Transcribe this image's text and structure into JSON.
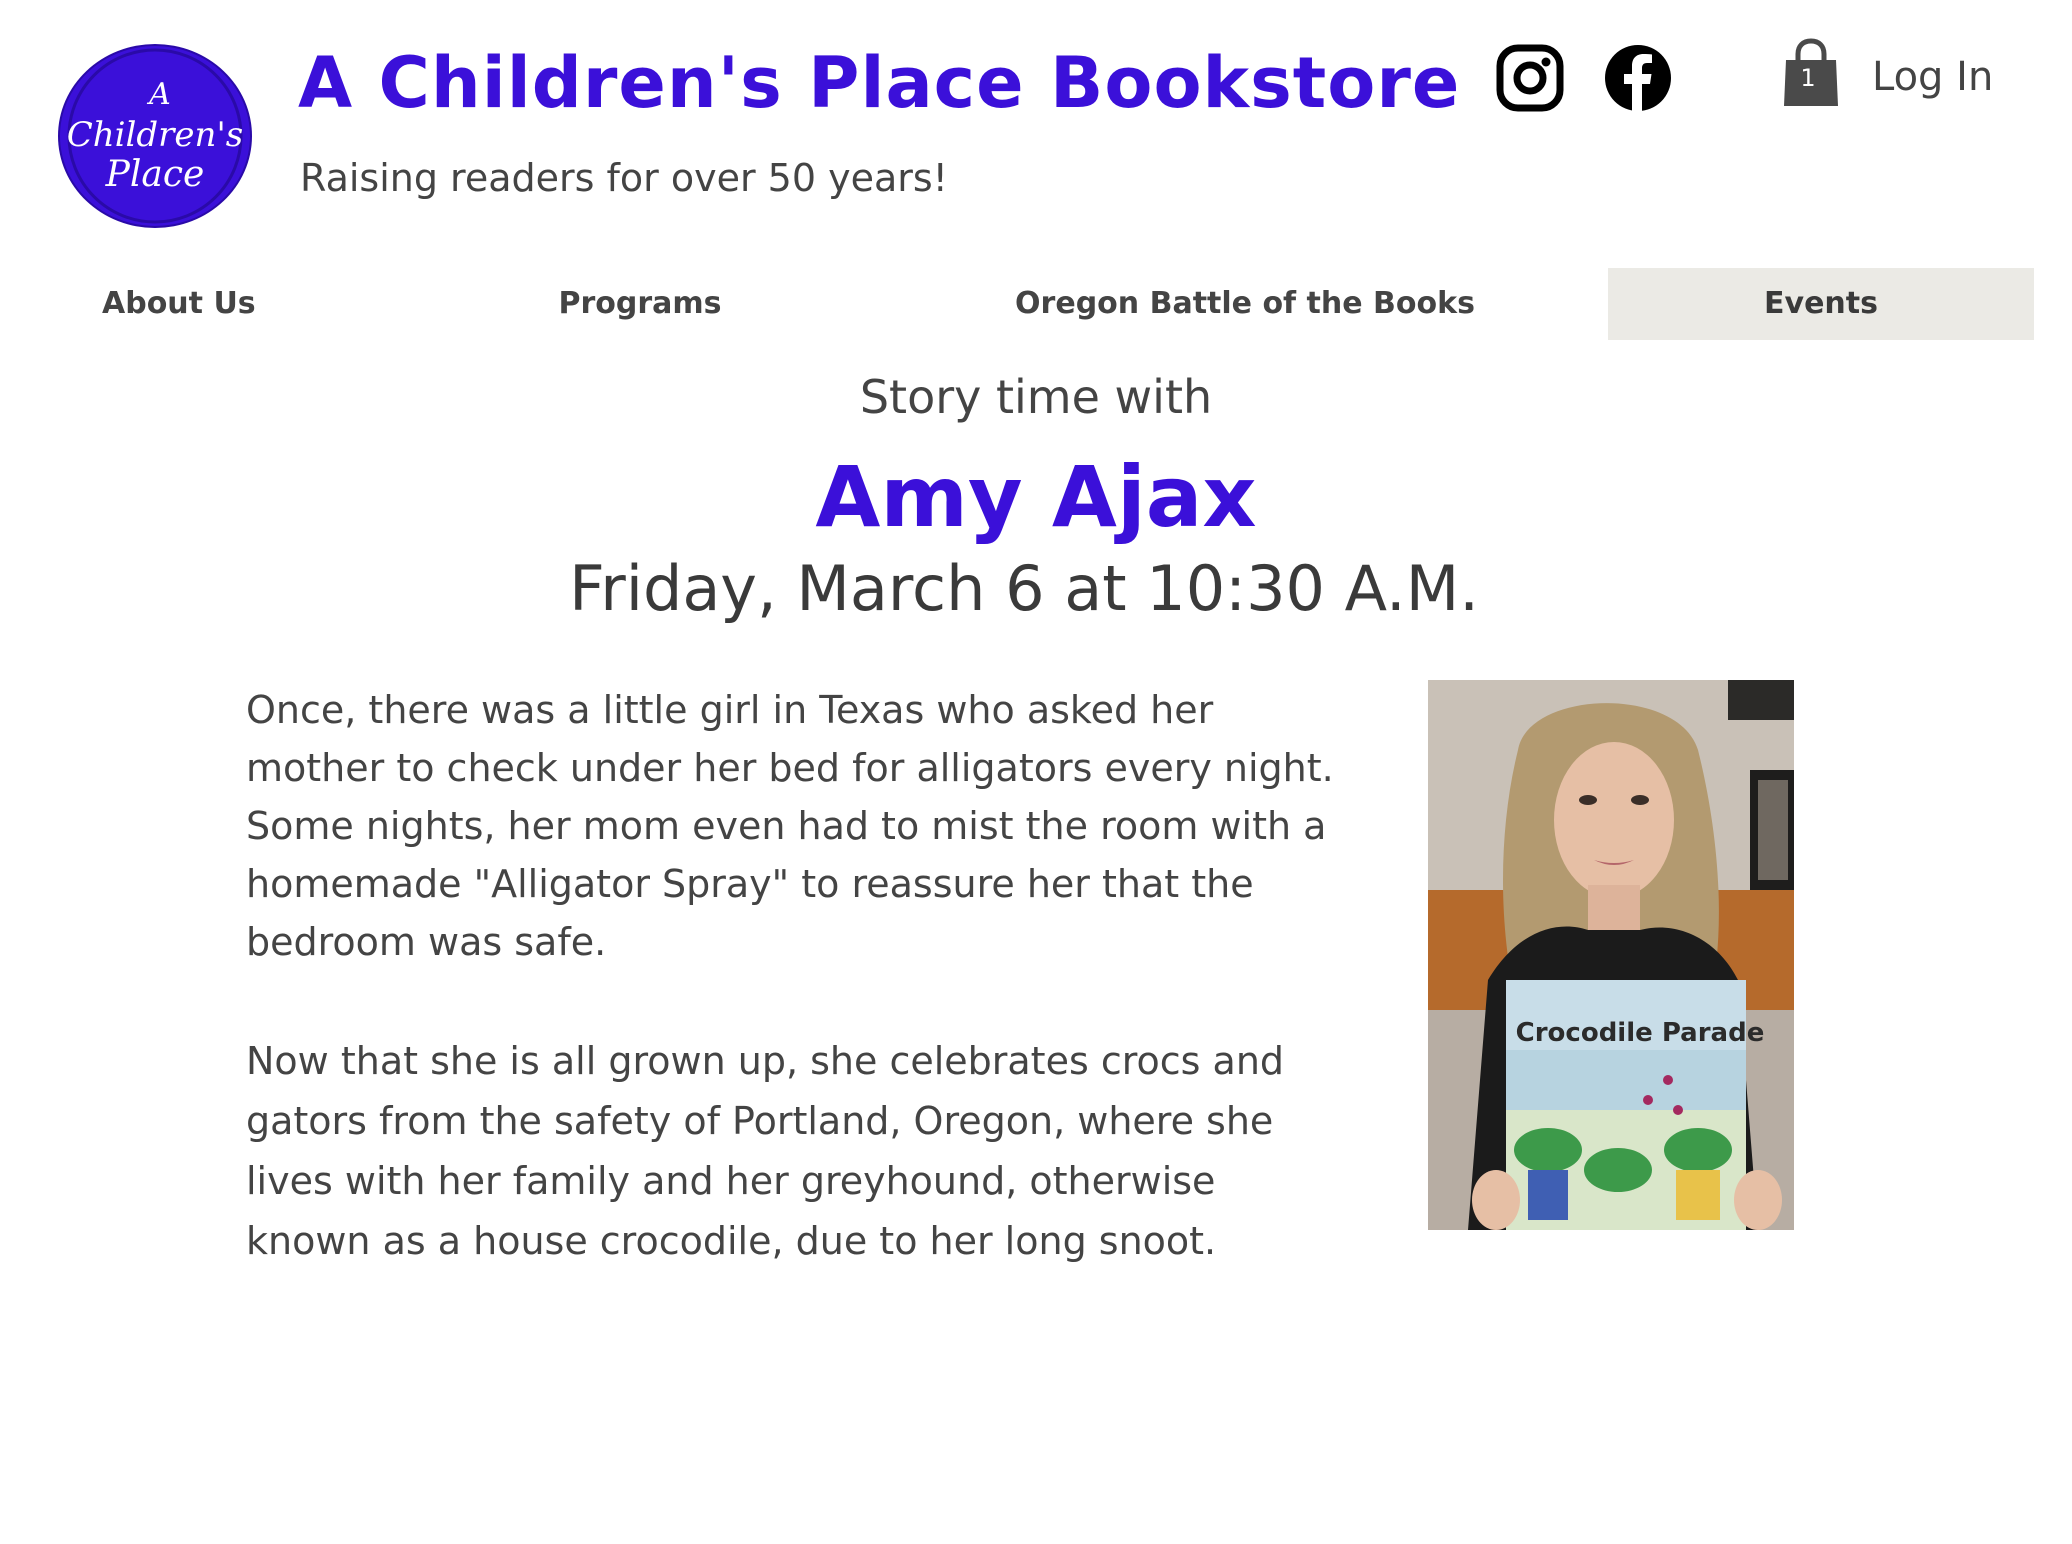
{
  "header": {
    "logo_text": "A Children's Place",
    "site_title": "A Children's Place Bookstore",
    "tagline": "Raising readers for over 50 years!",
    "social": [
      "instagram-icon",
      "facebook-icon"
    ],
    "cart_count": "1",
    "login_label": "Log In"
  },
  "nav": {
    "items": [
      {
        "label": "About Us"
      },
      {
        "label": "Programs"
      },
      {
        "label": "Oregon Battle of the Books"
      },
      {
        "label": "Events"
      }
    ],
    "active": "Events"
  },
  "event": {
    "intro": "Story time with",
    "name": "Amy Ajax",
    "date": "Friday, March 6 at 10:30 A.M.",
    "paragraphs": [
      "Once, there was a little girl in Texas who asked her mother to check under her bed for alligators every night. Some nights, her mom even had to mist the room with a homemade \"Alligator Spray\" to reassure her that the bedroom was safe.",
      "Now that she is all grown up, she celebrates crocs and gators from the safety of Portland, Oregon, where she lives with her family and her greyhound, otherwise known as a house crocodile, due to her long snoot."
    ],
    "photo": {
      "book_title": "Crocodile Parade"
    }
  },
  "colors": {
    "brand": "#3b10d9",
    "text": "#444444",
    "nav_active_bg": "#ebeae5"
  }
}
